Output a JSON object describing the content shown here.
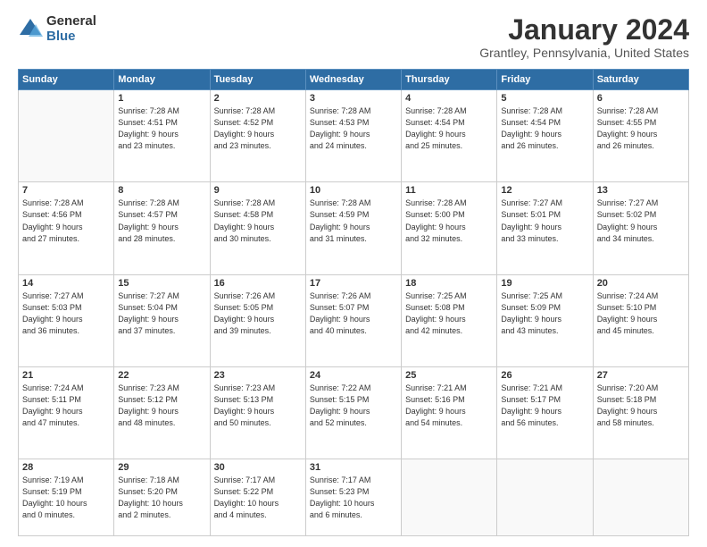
{
  "logo": {
    "general": "General",
    "blue": "Blue"
  },
  "title": "January 2024",
  "location": "Grantley, Pennsylvania, United States",
  "weekdays": [
    "Sunday",
    "Monday",
    "Tuesday",
    "Wednesday",
    "Thursday",
    "Friday",
    "Saturday"
  ],
  "weeks": [
    [
      {
        "day": "",
        "info": ""
      },
      {
        "day": "1",
        "info": "Sunrise: 7:28 AM\nSunset: 4:51 PM\nDaylight: 9 hours\nand 23 minutes."
      },
      {
        "day": "2",
        "info": "Sunrise: 7:28 AM\nSunset: 4:52 PM\nDaylight: 9 hours\nand 23 minutes."
      },
      {
        "day": "3",
        "info": "Sunrise: 7:28 AM\nSunset: 4:53 PM\nDaylight: 9 hours\nand 24 minutes."
      },
      {
        "day": "4",
        "info": "Sunrise: 7:28 AM\nSunset: 4:54 PM\nDaylight: 9 hours\nand 25 minutes."
      },
      {
        "day": "5",
        "info": "Sunrise: 7:28 AM\nSunset: 4:54 PM\nDaylight: 9 hours\nand 26 minutes."
      },
      {
        "day": "6",
        "info": "Sunrise: 7:28 AM\nSunset: 4:55 PM\nDaylight: 9 hours\nand 26 minutes."
      }
    ],
    [
      {
        "day": "7",
        "info": "Sunrise: 7:28 AM\nSunset: 4:56 PM\nDaylight: 9 hours\nand 27 minutes."
      },
      {
        "day": "8",
        "info": "Sunrise: 7:28 AM\nSunset: 4:57 PM\nDaylight: 9 hours\nand 28 minutes."
      },
      {
        "day": "9",
        "info": "Sunrise: 7:28 AM\nSunset: 4:58 PM\nDaylight: 9 hours\nand 30 minutes."
      },
      {
        "day": "10",
        "info": "Sunrise: 7:28 AM\nSunset: 4:59 PM\nDaylight: 9 hours\nand 31 minutes."
      },
      {
        "day": "11",
        "info": "Sunrise: 7:28 AM\nSunset: 5:00 PM\nDaylight: 9 hours\nand 32 minutes."
      },
      {
        "day": "12",
        "info": "Sunrise: 7:27 AM\nSunset: 5:01 PM\nDaylight: 9 hours\nand 33 minutes."
      },
      {
        "day": "13",
        "info": "Sunrise: 7:27 AM\nSunset: 5:02 PM\nDaylight: 9 hours\nand 34 minutes."
      }
    ],
    [
      {
        "day": "14",
        "info": "Sunrise: 7:27 AM\nSunset: 5:03 PM\nDaylight: 9 hours\nand 36 minutes."
      },
      {
        "day": "15",
        "info": "Sunrise: 7:27 AM\nSunset: 5:04 PM\nDaylight: 9 hours\nand 37 minutes."
      },
      {
        "day": "16",
        "info": "Sunrise: 7:26 AM\nSunset: 5:05 PM\nDaylight: 9 hours\nand 39 minutes."
      },
      {
        "day": "17",
        "info": "Sunrise: 7:26 AM\nSunset: 5:07 PM\nDaylight: 9 hours\nand 40 minutes."
      },
      {
        "day": "18",
        "info": "Sunrise: 7:25 AM\nSunset: 5:08 PM\nDaylight: 9 hours\nand 42 minutes."
      },
      {
        "day": "19",
        "info": "Sunrise: 7:25 AM\nSunset: 5:09 PM\nDaylight: 9 hours\nand 43 minutes."
      },
      {
        "day": "20",
        "info": "Sunrise: 7:24 AM\nSunset: 5:10 PM\nDaylight: 9 hours\nand 45 minutes."
      }
    ],
    [
      {
        "day": "21",
        "info": "Sunrise: 7:24 AM\nSunset: 5:11 PM\nDaylight: 9 hours\nand 47 minutes."
      },
      {
        "day": "22",
        "info": "Sunrise: 7:23 AM\nSunset: 5:12 PM\nDaylight: 9 hours\nand 48 minutes."
      },
      {
        "day": "23",
        "info": "Sunrise: 7:23 AM\nSunset: 5:13 PM\nDaylight: 9 hours\nand 50 minutes."
      },
      {
        "day": "24",
        "info": "Sunrise: 7:22 AM\nSunset: 5:15 PM\nDaylight: 9 hours\nand 52 minutes."
      },
      {
        "day": "25",
        "info": "Sunrise: 7:21 AM\nSunset: 5:16 PM\nDaylight: 9 hours\nand 54 minutes."
      },
      {
        "day": "26",
        "info": "Sunrise: 7:21 AM\nSunset: 5:17 PM\nDaylight: 9 hours\nand 56 minutes."
      },
      {
        "day": "27",
        "info": "Sunrise: 7:20 AM\nSunset: 5:18 PM\nDaylight: 9 hours\nand 58 minutes."
      }
    ],
    [
      {
        "day": "28",
        "info": "Sunrise: 7:19 AM\nSunset: 5:19 PM\nDaylight: 10 hours\nand 0 minutes."
      },
      {
        "day": "29",
        "info": "Sunrise: 7:18 AM\nSunset: 5:20 PM\nDaylight: 10 hours\nand 2 minutes."
      },
      {
        "day": "30",
        "info": "Sunrise: 7:17 AM\nSunset: 5:22 PM\nDaylight: 10 hours\nand 4 minutes."
      },
      {
        "day": "31",
        "info": "Sunrise: 7:17 AM\nSunset: 5:23 PM\nDaylight: 10 hours\nand 6 minutes."
      },
      {
        "day": "",
        "info": ""
      },
      {
        "day": "",
        "info": ""
      },
      {
        "day": "",
        "info": ""
      }
    ]
  ]
}
